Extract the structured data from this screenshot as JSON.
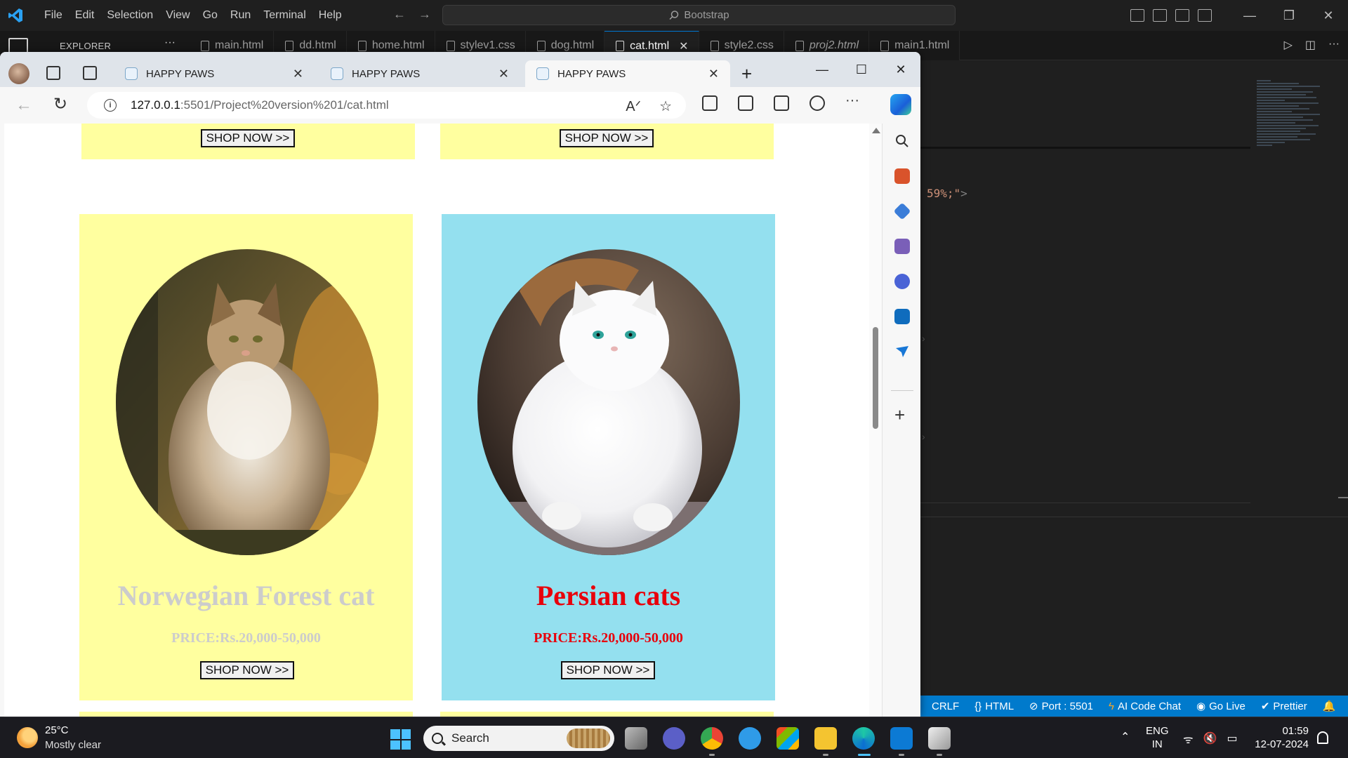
{
  "vscode": {
    "menu": [
      "File",
      "Edit",
      "Selection",
      "View",
      "Go",
      "Run",
      "Terminal",
      "Help"
    ],
    "command_center": "Bootstrap",
    "explorer_label": "EXPLORER",
    "tabs": [
      {
        "label": "main.html",
        "active": false,
        "italic": false
      },
      {
        "label": "dd.html",
        "active": false,
        "italic": false
      },
      {
        "label": "home.html",
        "active": false,
        "italic": false
      },
      {
        "label": "stylev1.css",
        "active": false,
        "italic": false
      },
      {
        "label": "dog.html",
        "active": false,
        "italic": false
      },
      {
        "label": "cat.html",
        "active": true,
        "italic": false
      },
      {
        "label": "style2.css",
        "active": false,
        "italic": false
      },
      {
        "label": "proj2.html",
        "active": false,
        "italic": true
      },
      {
        "label": "main1.html",
        "active": false,
        "italic": false
      }
    ],
    "code_fragment": "59%;\"",
    "code_fragment_close": ">",
    "statusbar": {
      "eol": "CRLF",
      "language": "HTML",
      "port": "Port : 5501",
      "ai": "AI Code Chat",
      "golive": "Go Live",
      "prettier": "Prettier"
    }
  },
  "browser": {
    "tabs": [
      {
        "title": "HAPPY PAWS",
        "active": false
      },
      {
        "title": "HAPPY PAWS",
        "active": false
      },
      {
        "title": "HAPPY PAWS",
        "active": true
      }
    ],
    "url_host": "127.0.0.1",
    "url_path": ":5501/Project%20version%201/cat.html"
  },
  "page": {
    "shop_label": "SHOP NOW >>",
    "cards": [
      {
        "name": "Norwegian Forest cat",
        "price": "PRICE:Rs.20,000-50,000",
        "bg": "#ffff9f",
        "text_color": "#000000"
      },
      {
        "name": "Persian cats",
        "price": "PRICE:Rs.20,000-50,000",
        "bg": "#94e0ef",
        "text_color": "#e8000b"
      }
    ]
  },
  "taskbar": {
    "weather_temp": "25°C",
    "weather_desc": "Mostly clear",
    "search_placeholder": "Search",
    "lang_line1": "ENG",
    "lang_line2": "IN",
    "time": "01:59",
    "date": "12-07-2024"
  }
}
